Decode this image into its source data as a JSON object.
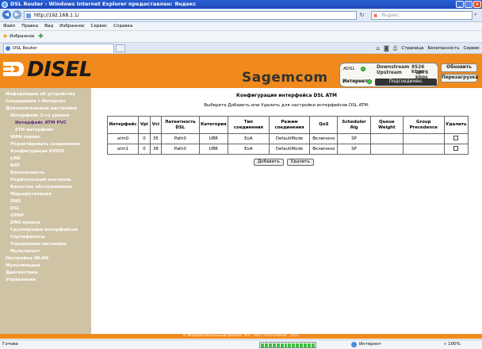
{
  "window": {
    "title": "DSL Router - Windows Internet Explorer предоставлен: Яндекс",
    "controls": {
      "minimize": "_",
      "maximize": "□",
      "close": "×"
    }
  },
  "addressbar": {
    "url": "http://192.168.1.1/",
    "search_placeholder": "Яндекс",
    "search_brand": "Я"
  },
  "menu": [
    "Файл",
    "Правка",
    "Вид",
    "Избранное",
    "Сервис",
    "Справка"
  ],
  "favorites": {
    "label": "Избранное"
  },
  "tab": {
    "label": "DSL Router"
  },
  "commands": {
    "page": "Страница",
    "security": "Безопасность",
    "service": "Сервис"
  },
  "header": {
    "logo": "DISEL",
    "brand": "Sagemcom",
    "adsl": "ADSL",
    "downstream_label": "Downstream",
    "downstream_value": "9526 kbps",
    "upstream_label": "Upstream",
    "upstream_value": "1076 kbps",
    "internet_label": "Интернет",
    "internet_status": "Подсоединен.",
    "refresh_button": "Обновить",
    "reboot_button": "Перезагрузка"
  },
  "sidebar": [
    {
      "label": "Информация об устройстве"
    },
    {
      "label": "Соединение с Интернет"
    },
    {
      "label": "Дополнительные настройки"
    },
    {
      "label": "Интерфейс 2-го уровня"
    },
    {
      "label": "Интерфейс ATM PVC"
    },
    {
      "label": "ETH интерфейс"
    },
    {
      "label": "WAN сервис"
    },
    {
      "label": "Редактировать соединения"
    },
    {
      "label": "Конфигурация EVDIO"
    },
    {
      "label": "LAN"
    },
    {
      "label": "NAT"
    },
    {
      "label": "Безопасность"
    },
    {
      "label": "Родительский контроль"
    },
    {
      "label": "Качество обслуживания"
    },
    {
      "label": "Маршрутизация"
    },
    {
      "label": "DNS"
    },
    {
      "label": "DSL"
    },
    {
      "label": "UPNP"
    },
    {
      "label": "DNS-прокси"
    },
    {
      "label": "Группировка интерфейсов"
    },
    {
      "label": "Сертификаты"
    },
    {
      "label": "Управление питанием"
    },
    {
      "label": "Мультикаст"
    },
    {
      "label": "Настройка WLAN"
    },
    {
      "label": "Мультимедиа"
    },
    {
      "label": "Диагностика"
    },
    {
      "label": "Управление"
    }
  ],
  "main": {
    "title": "Конфигурация интерфейса DSL ATM",
    "subtitle": "Выберете Добавить или Удалить для настройки интерфейсов DSL ATM.",
    "table": {
      "headers": [
        "Интерфейс",
        "Vpi",
        "Vci",
        "Латентность DSL",
        "Категория",
        "Тип соединения",
        "Режим соединения",
        "QoS",
        "Scheduler Alg",
        "Queue Weight",
        "Group Precedence",
        "Удалить"
      ],
      "rows": [
        [
          "atm0",
          "0",
          "35",
          "Path0",
          "UBR",
          "EoA",
          "DefaultMode",
          "Включено",
          "SP",
          "",
          ""
        ],
        [
          "atm1",
          "0",
          "38",
          "Path0",
          "UBR",
          "EoA",
          "DefaultMode",
          "Включено",
          "SP",
          "",
          ""
        ]
      ]
    },
    "add_button": "Добавить",
    "remove_button": "Удалить"
  },
  "footer": {
    "text": "© Макрорегиональный филиал \"Юг\" ОАО \"Ростелеком\", 2011"
  },
  "statusbar": {
    "left": "Готово",
    "zone": "Интернет",
    "zoom": "100%"
  }
}
